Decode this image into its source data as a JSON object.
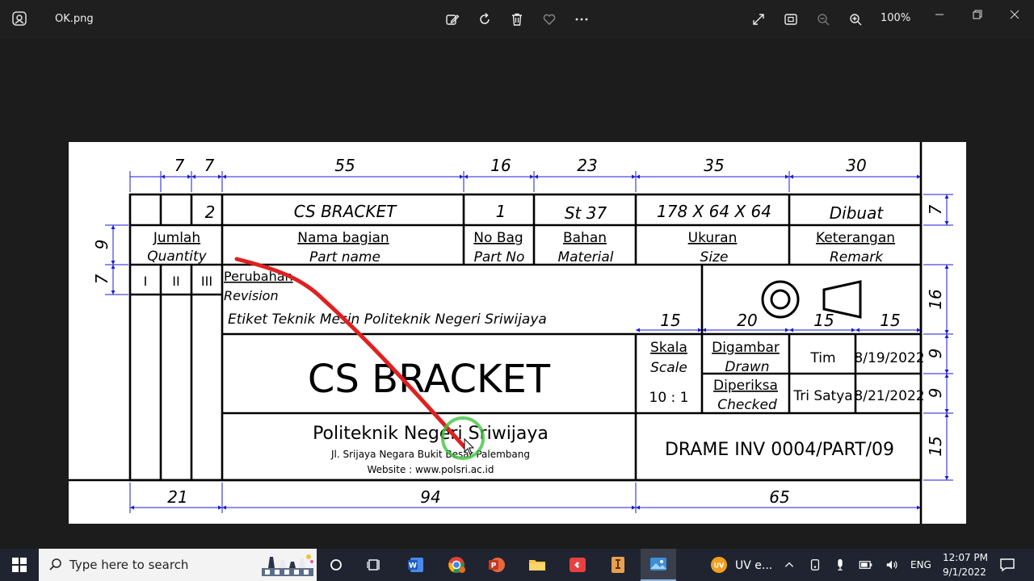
{
  "window": {
    "filename": "OK.png",
    "zoom": "100%"
  },
  "drawing": {
    "dims_top": [
      "7",
      "7",
      "55",
      "16",
      "23",
      "35",
      "30"
    ],
    "dims_bottom": [
      "21",
      "94",
      "65"
    ],
    "dims_right": [
      "7",
      "16",
      "9",
      "9",
      "15"
    ],
    "dims_left": [
      "9",
      "7"
    ],
    "dims_mid": [
      "15",
      "20",
      "15",
      "15"
    ],
    "row1": {
      "qty": "2",
      "part_name": "CS BRACKET",
      "part_no": "1",
      "material": "St 37",
      "size": "178 X 64 X 64",
      "remark": "Dibuat"
    },
    "headers": {
      "qty_id": "Jumlah",
      "qty_en": "Quantity",
      "name_id": "Nama bagian",
      "name_en": "Part name",
      "no_id": "No Bag",
      "no_en": "Part No",
      "mat_id": "Bahan",
      "mat_en": "Material",
      "size_id": "Ukuran",
      "size_en": "Size",
      "rem_id": "Keterangan",
      "rem_en": "Remark"
    },
    "revision_cols": [
      "I",
      "II",
      "III"
    ],
    "revision_id": "Perubahan",
    "revision_en": "Revision",
    "etiket": "Etiket Teknik Mesin Politeknik Negeri Sriwijaya",
    "title": "CS BRACKET",
    "scale_id": "Skala",
    "scale_en": "Scale",
    "scale_value": "10 : 1",
    "drawn_id": "Digambar",
    "drawn_en": "Drawn",
    "checked_id": "Diperiksa",
    "checked_en": "Checked",
    "drawn_by": "Tim",
    "checked_by": "Tri Satya",
    "drawn_date": "8/19/2022",
    "checked_date": "8/21/2022",
    "institution": "Politeknik Negeri Sriwijaya",
    "address": "Jl. Srijaya Negara Bukit Besar Palembang",
    "website": "Website : www.polsri.ac.id",
    "drawing_number": "DRAME INV 0004/PART/09"
  },
  "taskbar": {
    "search_placeholder": "Type here to search",
    "notification_app": "UV e...",
    "language": "ENG",
    "time": "12:07 PM",
    "date": "9/1/2022"
  },
  "colors": {
    "dimension": "#1b1bd4",
    "annotation": "#e02020",
    "highlight": "#3ec43e"
  }
}
